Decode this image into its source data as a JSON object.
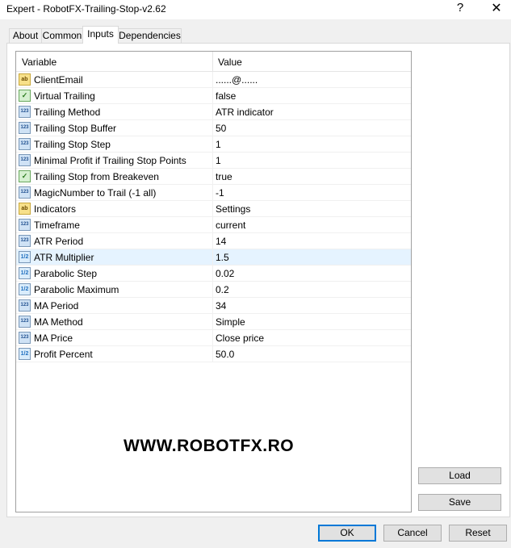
{
  "window": {
    "title": "Expert - RobotFX-Trailing-Stop-v2.62",
    "help_glyph": "?",
    "close_glyph": "✕"
  },
  "tabs": [
    {
      "label": "About"
    },
    {
      "label": "Common"
    },
    {
      "label": "Inputs",
      "active": true
    },
    {
      "label": "Dependencies"
    }
  ],
  "grid": {
    "col_variable": "Variable",
    "col_value": "Value",
    "rows": [
      {
        "icon": "ab",
        "name": "ClientEmail",
        "value": "......@......"
      },
      {
        "icon": "bool",
        "name": "Virtual Trailing",
        "value": "false"
      },
      {
        "icon": "123",
        "name": "Trailing Method",
        "value": "ATR indicator"
      },
      {
        "icon": "123",
        "name": "Trailing Stop Buffer",
        "value": "50"
      },
      {
        "icon": "123",
        "name": "Trailing Stop Step",
        "value": "1"
      },
      {
        "icon": "123",
        "name": "Minimal Profit if Trailing Stop Points",
        "value": "1"
      },
      {
        "icon": "bool",
        "name": "Trailing Stop from Breakeven",
        "value": "true"
      },
      {
        "icon": "123",
        "name": "MagicNumber to Trail (-1 all)",
        "value": "-1"
      },
      {
        "icon": "ab",
        "name": "Indicators",
        "value": "Settings"
      },
      {
        "icon": "123",
        "name": "Timeframe",
        "value": "current"
      },
      {
        "icon": "123",
        "name": "ATR Period",
        "value": "14"
      },
      {
        "icon": "dbl",
        "name": "ATR Multiplier",
        "value": "1.5",
        "selected": true
      },
      {
        "icon": "dbl",
        "name": "Parabolic Step",
        "value": "0.02"
      },
      {
        "icon": "dbl",
        "name": "Parabolic Maximum",
        "value": "0.2"
      },
      {
        "icon": "123",
        "name": "MA Period",
        "value": "34"
      },
      {
        "icon": "123",
        "name": "MA Method",
        "value": "Simple"
      },
      {
        "icon": "123",
        "name": "MA Price",
        "value": "Close price"
      },
      {
        "icon": "dbl",
        "name": "Profit Percent",
        "value": "50.0"
      }
    ]
  },
  "watermark": "WWW.ROBOTFX.RO",
  "buttons": {
    "load": "Load",
    "save": "Save",
    "ok": "OK",
    "cancel": "Cancel",
    "reset": "Reset"
  },
  "icon_glyphs": {
    "ab": "ab",
    "123": "123",
    "bool": "✓",
    "dbl": "1/2"
  }
}
